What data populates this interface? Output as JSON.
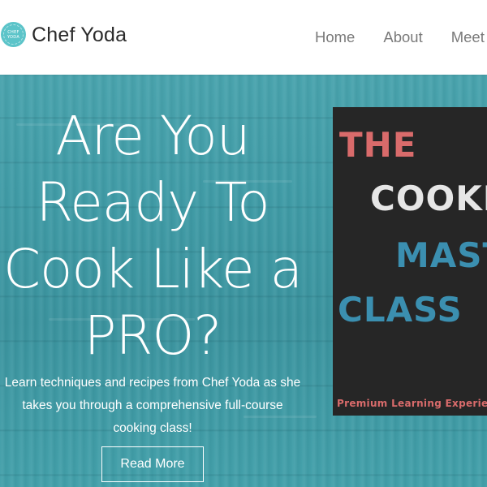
{
  "brand": {
    "logo_text": [
      "CHEF",
      "YODA"
    ],
    "name": "Chef Yoda"
  },
  "nav": {
    "items": [
      {
        "label": "Home"
      },
      {
        "label": "About"
      },
      {
        "label": "Meet the Chef"
      }
    ]
  },
  "hero": {
    "headline_lines": [
      "Are You",
      "Ready To",
      "Cook Like a",
      "PRO?"
    ],
    "subtext": "Learn techniques and recipes from Chef Yoda as she takes you through a comprehensive full-course cooking class!",
    "cta_label": "Read More"
  },
  "poster": {
    "lines": [
      "THE",
      "COOKING",
      "MASTER",
      "CLASS"
    ],
    "tagline": "Premium Learning Experience"
  },
  "colors": {
    "accent_teal": "#5cc4c9",
    "hero_bg": "#3f9ba6",
    "poster_bg": "#262626",
    "poster_red": "#d96b6b",
    "poster_blue": "#3b8fb0"
  }
}
